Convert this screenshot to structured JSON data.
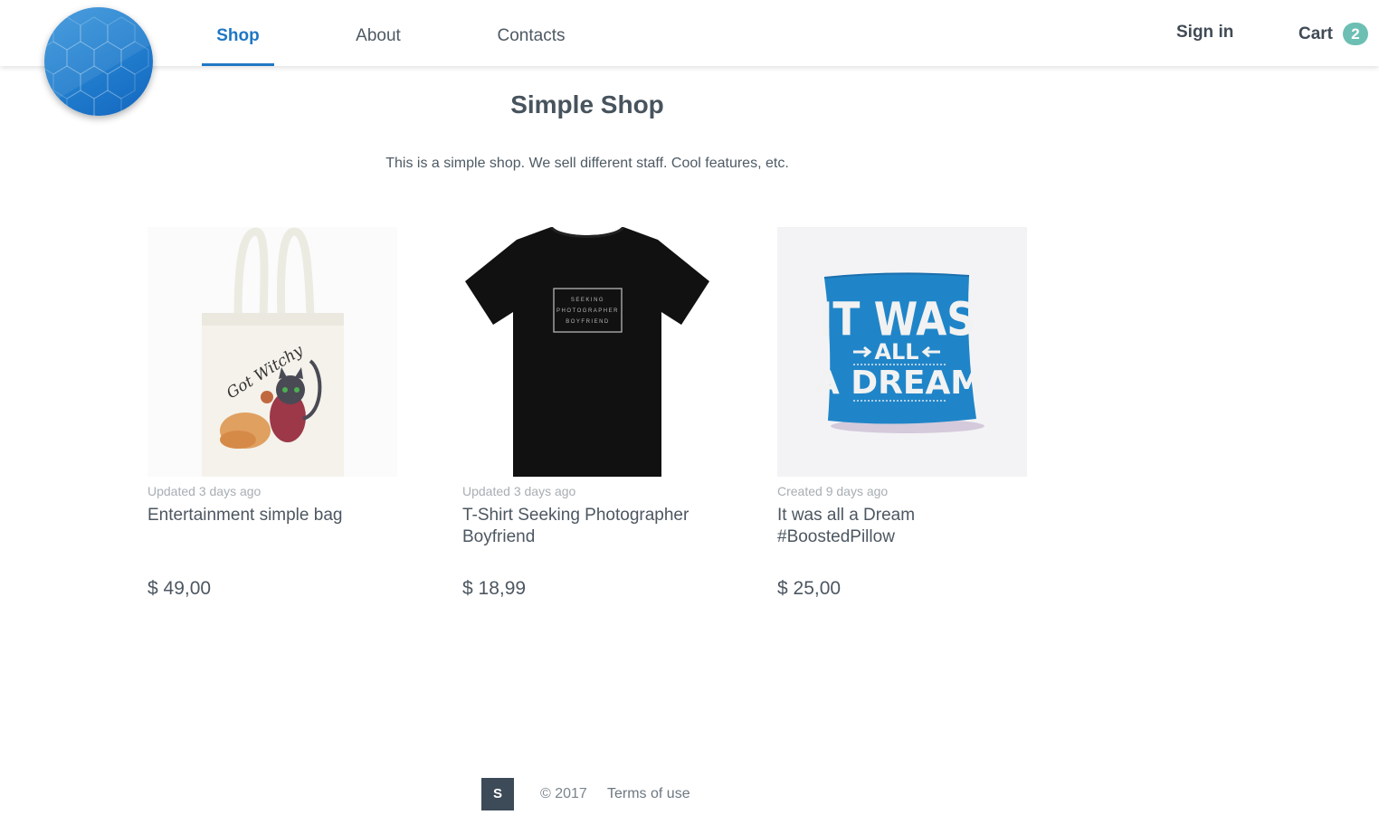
{
  "header": {
    "nav": [
      {
        "label": "Shop",
        "active": true
      },
      {
        "label": "About",
        "active": false
      },
      {
        "label": "Contacts",
        "active": false
      }
    ],
    "sign_in_label": "Sign in",
    "cart_label": "Cart",
    "cart_count": "2",
    "accent_color": "#1f77c4",
    "badge_color": "#6dbfb3"
  },
  "main": {
    "title": "Simple Shop",
    "description": "This is a simple shop. We sell different staff. Cool features, etc.",
    "products": [
      {
        "meta": "Updated 3 days ago",
        "title": "Entertainment simple bag",
        "price": "$ 49,00",
        "image_icon": "tote-bag-image",
        "image_text": "Got Witchy"
      },
      {
        "meta": "Updated 3 days ago",
        "title": "T-Shirt Seeking Photographer Boyfriend",
        "price": "$ 18,99",
        "image_icon": "tshirt-image",
        "image_text": [
          "SEEKING",
          "PHOTOGRAPHER",
          "BOYFRIEND"
        ]
      },
      {
        "meta": "Created 9 days ago",
        "title": "It was all a Dream #BoostedPillow",
        "price": "$ 25,00",
        "image_icon": "pillow-image",
        "image_text": [
          "IT WAS",
          "ALL",
          "A DREAM"
        ]
      }
    ]
  },
  "footer": {
    "logo_letter": "S",
    "copyright": "© 2017",
    "terms_label": "Terms of use"
  }
}
